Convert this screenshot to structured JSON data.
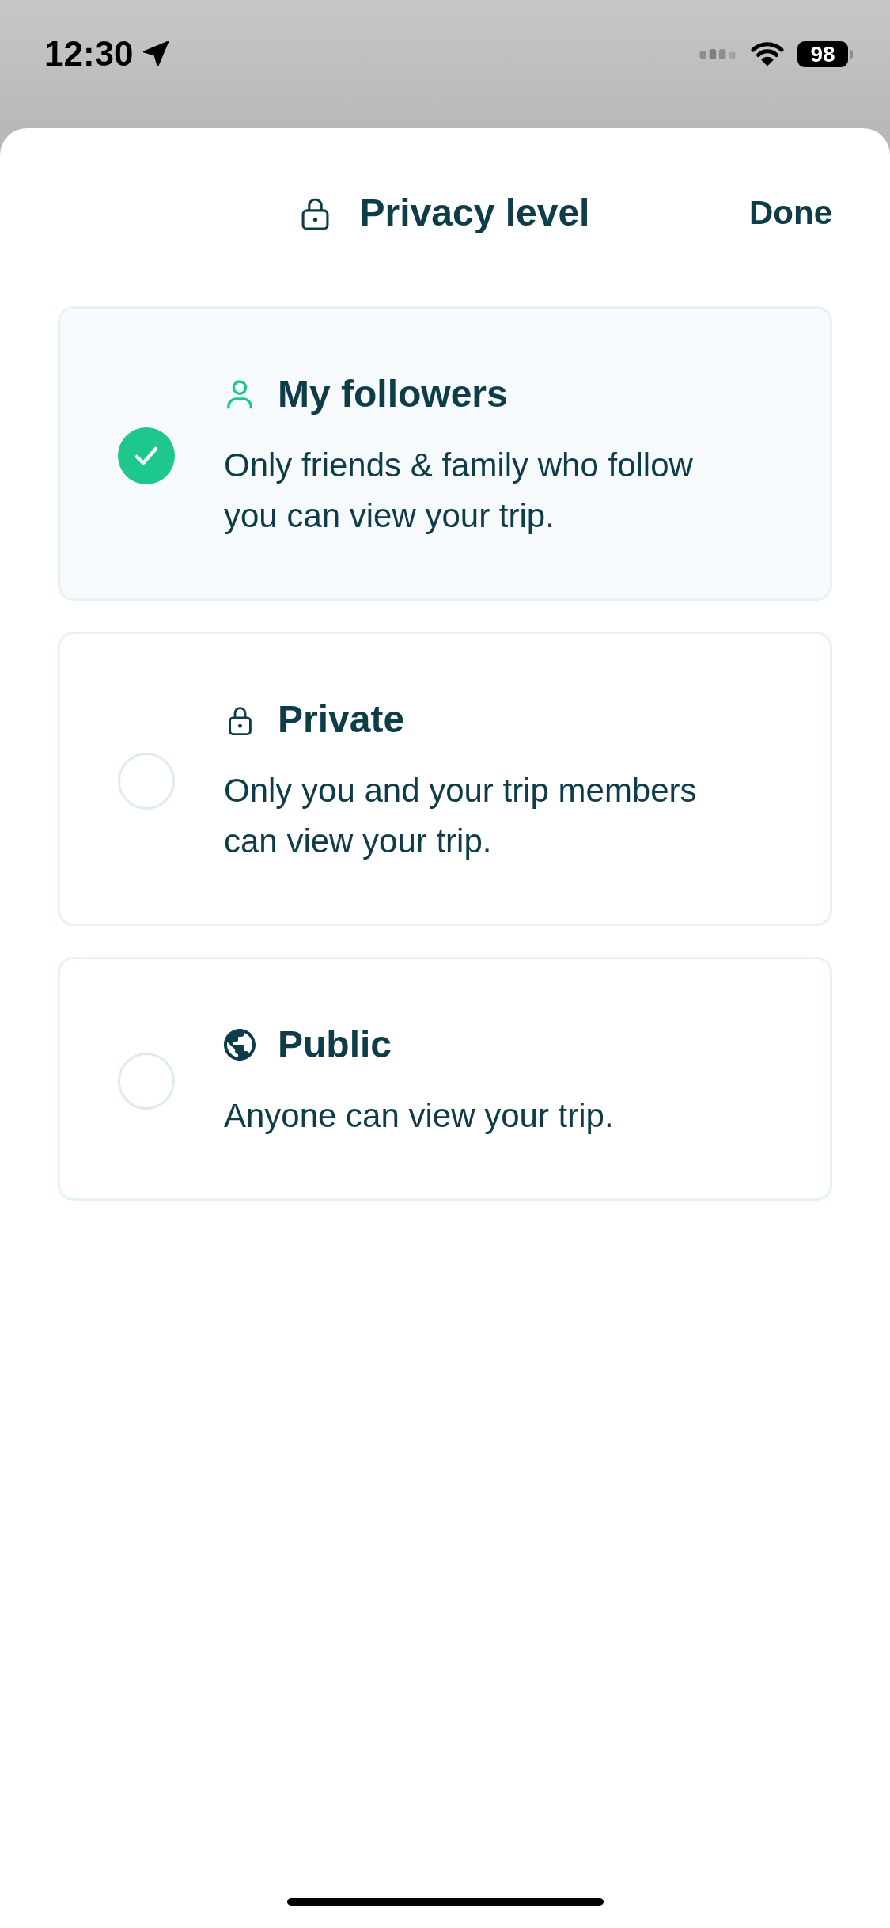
{
  "status_bar": {
    "time": "12:30",
    "battery": "98"
  },
  "sheet": {
    "title": "Privacy level",
    "done": "Done"
  },
  "options": [
    {
      "kind": "followers",
      "title": "My followers",
      "description": "Only friends & family who follow you can view your trip.",
      "selected": true
    },
    {
      "kind": "private",
      "title": "Private",
      "description": "Only you and your trip members can view your trip.",
      "selected": false
    },
    {
      "kind": "public",
      "title": "Public",
      "description": "Anyone can view your trip.",
      "selected": false
    }
  ]
}
